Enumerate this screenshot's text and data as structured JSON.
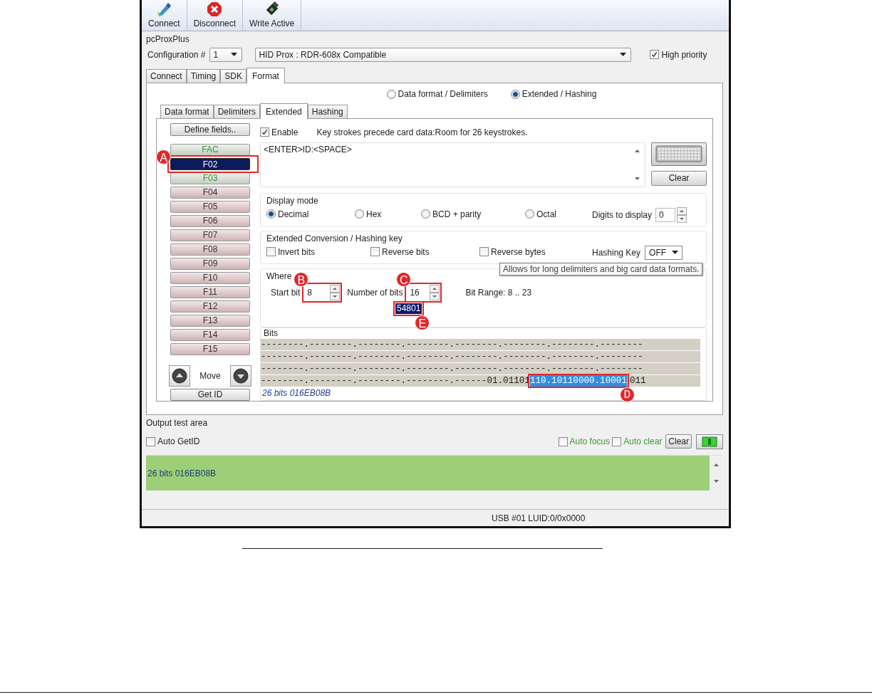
{
  "toolbar": [
    {
      "label": "Connect",
      "kind": "connect"
    },
    {
      "label": "Disconnect",
      "kind": "disconnect"
    },
    {
      "label": "Write Active",
      "kind": "write"
    }
  ],
  "group_title": "pcProxPlus",
  "configuration": {
    "label": "Configuration #",
    "value": "1"
  },
  "device": {
    "value": "HID Prox : RDR-608x Compatible"
  },
  "high_priority": {
    "label": "High priority",
    "checked": true
  },
  "tabs": [
    {
      "label": "Connect",
      "selected": false
    },
    {
      "label": "Timing",
      "selected": false
    },
    {
      "label": "SDK",
      "selected": false
    },
    {
      "label": "Format",
      "selected": true
    }
  ],
  "mode_radios": [
    {
      "label": "Data format / Delimiters",
      "selected": false
    },
    {
      "label": "Extended / Hashing",
      "selected": true
    }
  ],
  "subtabs": [
    {
      "label": "Data format",
      "selected": false
    },
    {
      "label": "Delimiters",
      "selected": false
    },
    {
      "label": "Extended",
      "selected": true
    },
    {
      "label": "Hashing",
      "selected": false
    }
  ],
  "define_fields": "Define fields..",
  "fields": [
    {
      "label": "FAC",
      "kind": "used",
      "selected": false
    },
    {
      "label": "F02",
      "kind": "used",
      "selected": true,
      "callout": "A"
    },
    {
      "label": "F03",
      "kind": "used",
      "selected": false
    },
    {
      "label": "F04",
      "kind": "empty",
      "selected": false
    },
    {
      "label": "F05",
      "kind": "empty",
      "selected": false
    },
    {
      "label": "F06",
      "kind": "empty",
      "selected": false
    },
    {
      "label": "F07",
      "kind": "empty",
      "selected": false
    },
    {
      "label": "F08",
      "kind": "empty",
      "selected": false
    },
    {
      "label": "F09",
      "kind": "empty",
      "selected": false
    },
    {
      "label": "F10",
      "kind": "empty",
      "selected": false
    },
    {
      "label": "F11",
      "kind": "empty",
      "selected": false
    },
    {
      "label": "F12",
      "kind": "empty",
      "selected": false
    },
    {
      "label": "F13",
      "kind": "empty",
      "selected": false
    },
    {
      "label": "F14",
      "kind": "empty",
      "selected": false
    },
    {
      "label": "F15",
      "kind": "empty",
      "selected": false
    }
  ],
  "move_label": "Move",
  "get_id": "Get ID",
  "enable": {
    "label": "Enable",
    "checked": true
  },
  "keystroke_info": "Key strokes precede card data:Room for 26 keystrokes.",
  "keystrokes": "<ENTER>ID:<SPACE>",
  "clear_button": "Clear",
  "display_mode": {
    "title": "Display mode",
    "options": [
      {
        "label": "Decimal",
        "selected": true
      },
      {
        "label": "Hex",
        "selected": false
      },
      {
        "label": "BCD + parity",
        "selected": false
      },
      {
        "label": "Octal",
        "selected": false
      }
    ],
    "digits_label": "Digits to display",
    "digits_value": "0"
  },
  "conversion": {
    "title": "Extended Conversion / Hashing key",
    "options": [
      {
        "label": "Invert  bits",
        "checked": false
      },
      {
        "label": "Reverse bits",
        "checked": false
      },
      {
        "label": "Reverse bytes",
        "checked": false
      }
    ],
    "hashing_label": "Hashing Key",
    "hashing_value": "OFF"
  },
  "tooltip": "Allows for long delimiters and big card data formats.",
  "where": {
    "title": "Where",
    "start_label": "Start bit",
    "start_value": "8",
    "count_label": "Number of bits",
    "count_value": "16",
    "range": "Bit Range: 8 .. 23",
    "result": "54801",
    "start_callout": "B",
    "count_callout": "C",
    "result_callout": "E"
  },
  "bits": {
    "title": "Bits",
    "rows": [
      [
        {
          "text": "--------.--------.--------.--------.--------.--------.--------.--------",
          "selected": false
        }
      ],
      [
        {
          "text": "--------.--------.--------.--------.--------.--------.--------.--------",
          "selected": false
        }
      ],
      [
        {
          "text": "--------.--------.--------.--------.--------.--------.--------.--------",
          "selected": false
        }
      ],
      [
        {
          "text": "--------.--------.--------.--------.------01.01101",
          "selected": false
        },
        {
          "text": "110.10110000.10001",
          "selected": true,
          "callout": "D"
        },
        {
          "text": "011",
          "selected": false
        }
      ]
    ],
    "summary": "26 bits 016EB08B"
  },
  "output": {
    "title": "Output test area",
    "auto_getid": {
      "label": "Auto GetID",
      "checked": false
    },
    "auto_focus": {
      "label": "Auto focus",
      "checked": false
    },
    "auto_clear": {
      "label": "Auto clear",
      "checked": false
    },
    "clear": "Clear",
    "text": "26 bits 016EB08B"
  },
  "status_bar": "USB #01 LUID:0/0x0000"
}
